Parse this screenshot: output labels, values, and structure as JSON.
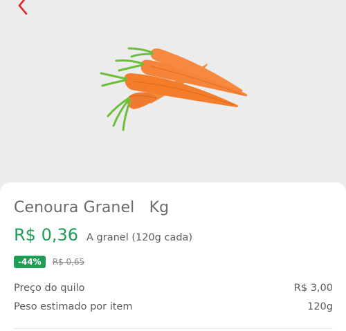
{
  "nav": {
    "back_icon": "chevron-left-icon",
    "accent_color": "#e3262e"
  },
  "product": {
    "image_icon": "carrot-bunch-image",
    "title": "Cenoura Granel   Kg",
    "price": "R$ 0,36",
    "price_note": "A granel (120g cada)",
    "discount_badge": "-44%",
    "old_price": "R$ 0,65",
    "price_color": "#1f9d55"
  },
  "details": [
    {
      "label": "Preço do quilo",
      "value": "R$ 3,00"
    },
    {
      "label": "Peso estimado por item",
      "value": "120g"
    }
  ]
}
